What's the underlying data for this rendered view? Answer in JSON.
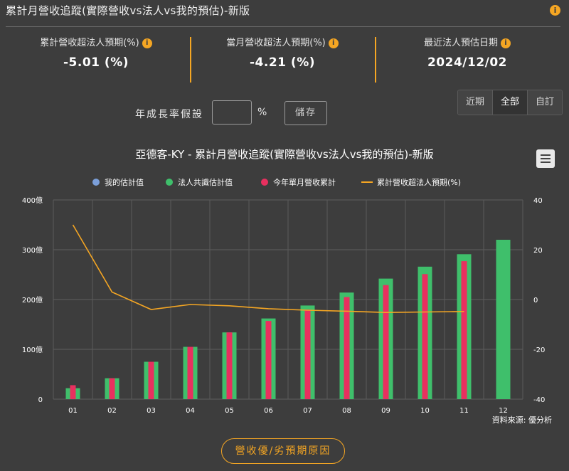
{
  "header": {
    "title": "累計月營收追蹤(實際營收vs法人vs我的預估)-新版",
    "info_icon": "i"
  },
  "stats": [
    {
      "label": "累計營收超法人預期(%)",
      "value": "-5.01 (%)",
      "has_info": true
    },
    {
      "label": "當月營收超法人預期(%)",
      "value": "-4.21 (%)",
      "has_info": true
    },
    {
      "label": "最近法人預估日期",
      "value": "2024/12/02",
      "has_info": true
    }
  ],
  "range_tabs": [
    {
      "label": "近期",
      "active": false
    },
    {
      "label": "全部",
      "active": true
    },
    {
      "label": "自訂",
      "active": false
    }
  ],
  "growth": {
    "label": "年成長率假設",
    "input_value": "",
    "unit": "%",
    "save_label": "儲存"
  },
  "chart_data": {
    "type": "bar",
    "title": "亞德客-KY - 累計月營收追蹤(實際營收vs法人vs我的預估)-新版",
    "categories": [
      "01",
      "02",
      "03",
      "04",
      "05",
      "06",
      "07",
      "08",
      "09",
      "10",
      "11",
      "12"
    ],
    "y_left": {
      "ticks": [
        "400億",
        "300億",
        "200億",
        "100億",
        "0"
      ],
      "range": [
        0,
        400
      ]
    },
    "y_right": {
      "ticks": [
        "40",
        "20",
        "0",
        "-20",
        "-40"
      ],
      "range": [
        -40,
        40
      ]
    },
    "legend": {
      "placement": "top"
    },
    "grid": true,
    "colors": {
      "mine": "#7b9fd9",
      "consensus": "#3fbf6b",
      "actual": "#e8305f",
      "line": "#f5a623"
    },
    "series": [
      {
        "name": "我的估計值",
        "type": "bar",
        "values": []
      },
      {
        "name": "法人共識估計值",
        "type": "bar",
        "values": [
          22,
          42,
          75,
          105,
          134,
          162,
          188,
          214,
          242,
          266,
          291,
          320
        ]
      },
      {
        "name": "今年單月營收累計",
        "type": "bar",
        "values": [
          28,
          42,
          75,
          105,
          134,
          157,
          180,
          205,
          229,
          251,
          277,
          null
        ]
      },
      {
        "name": "累計營收超法人預期(%)",
        "type": "line",
        "axis": "right",
        "values": [
          30,
          3,
          -4,
          -2,
          -2.5,
          -3.7,
          -4.3,
          -4.7,
          -5.2,
          -5.0,
          -4.8,
          null
        ]
      }
    ]
  },
  "source_text": "資料來源: 優分析",
  "reason_button": "營收優/劣預期原因"
}
